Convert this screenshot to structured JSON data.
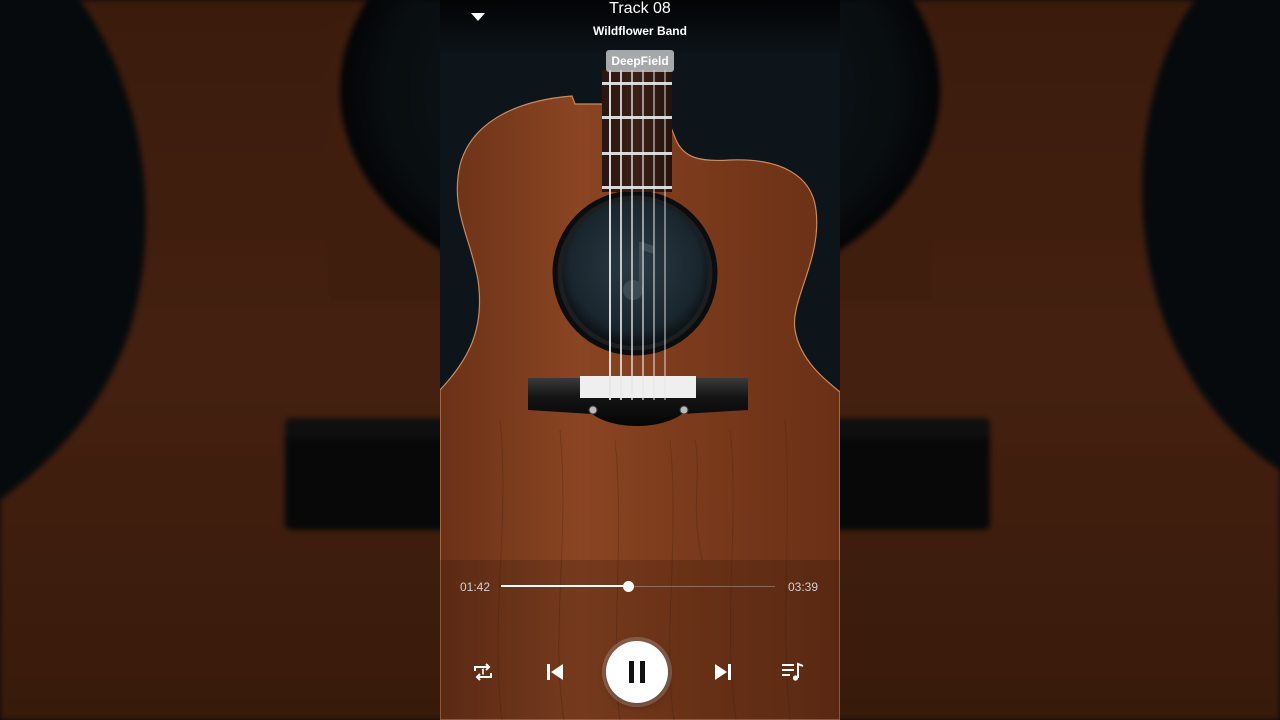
{
  "app": {
    "title": "Track 08",
    "artist": "Wildflower Band",
    "quality_badge": "DeepField"
  },
  "playback": {
    "elapsed": "01:42",
    "duration": "03:39",
    "progress": 0.466,
    "state": "playing"
  },
  "controls": {
    "collapse_icon": "chevron-down-icon",
    "repeat_icon": "repeat-icon",
    "previous_icon": "skip-previous-icon",
    "pause_icon": "pause-icon",
    "next_icon": "skip-next-icon",
    "playlist_icon": "playlist-icon"
  },
  "colors": {
    "wood": "#7a3a1a",
    "background": "#0c1318",
    "text": "#ffffff",
    "accent": "#ffffff"
  }
}
